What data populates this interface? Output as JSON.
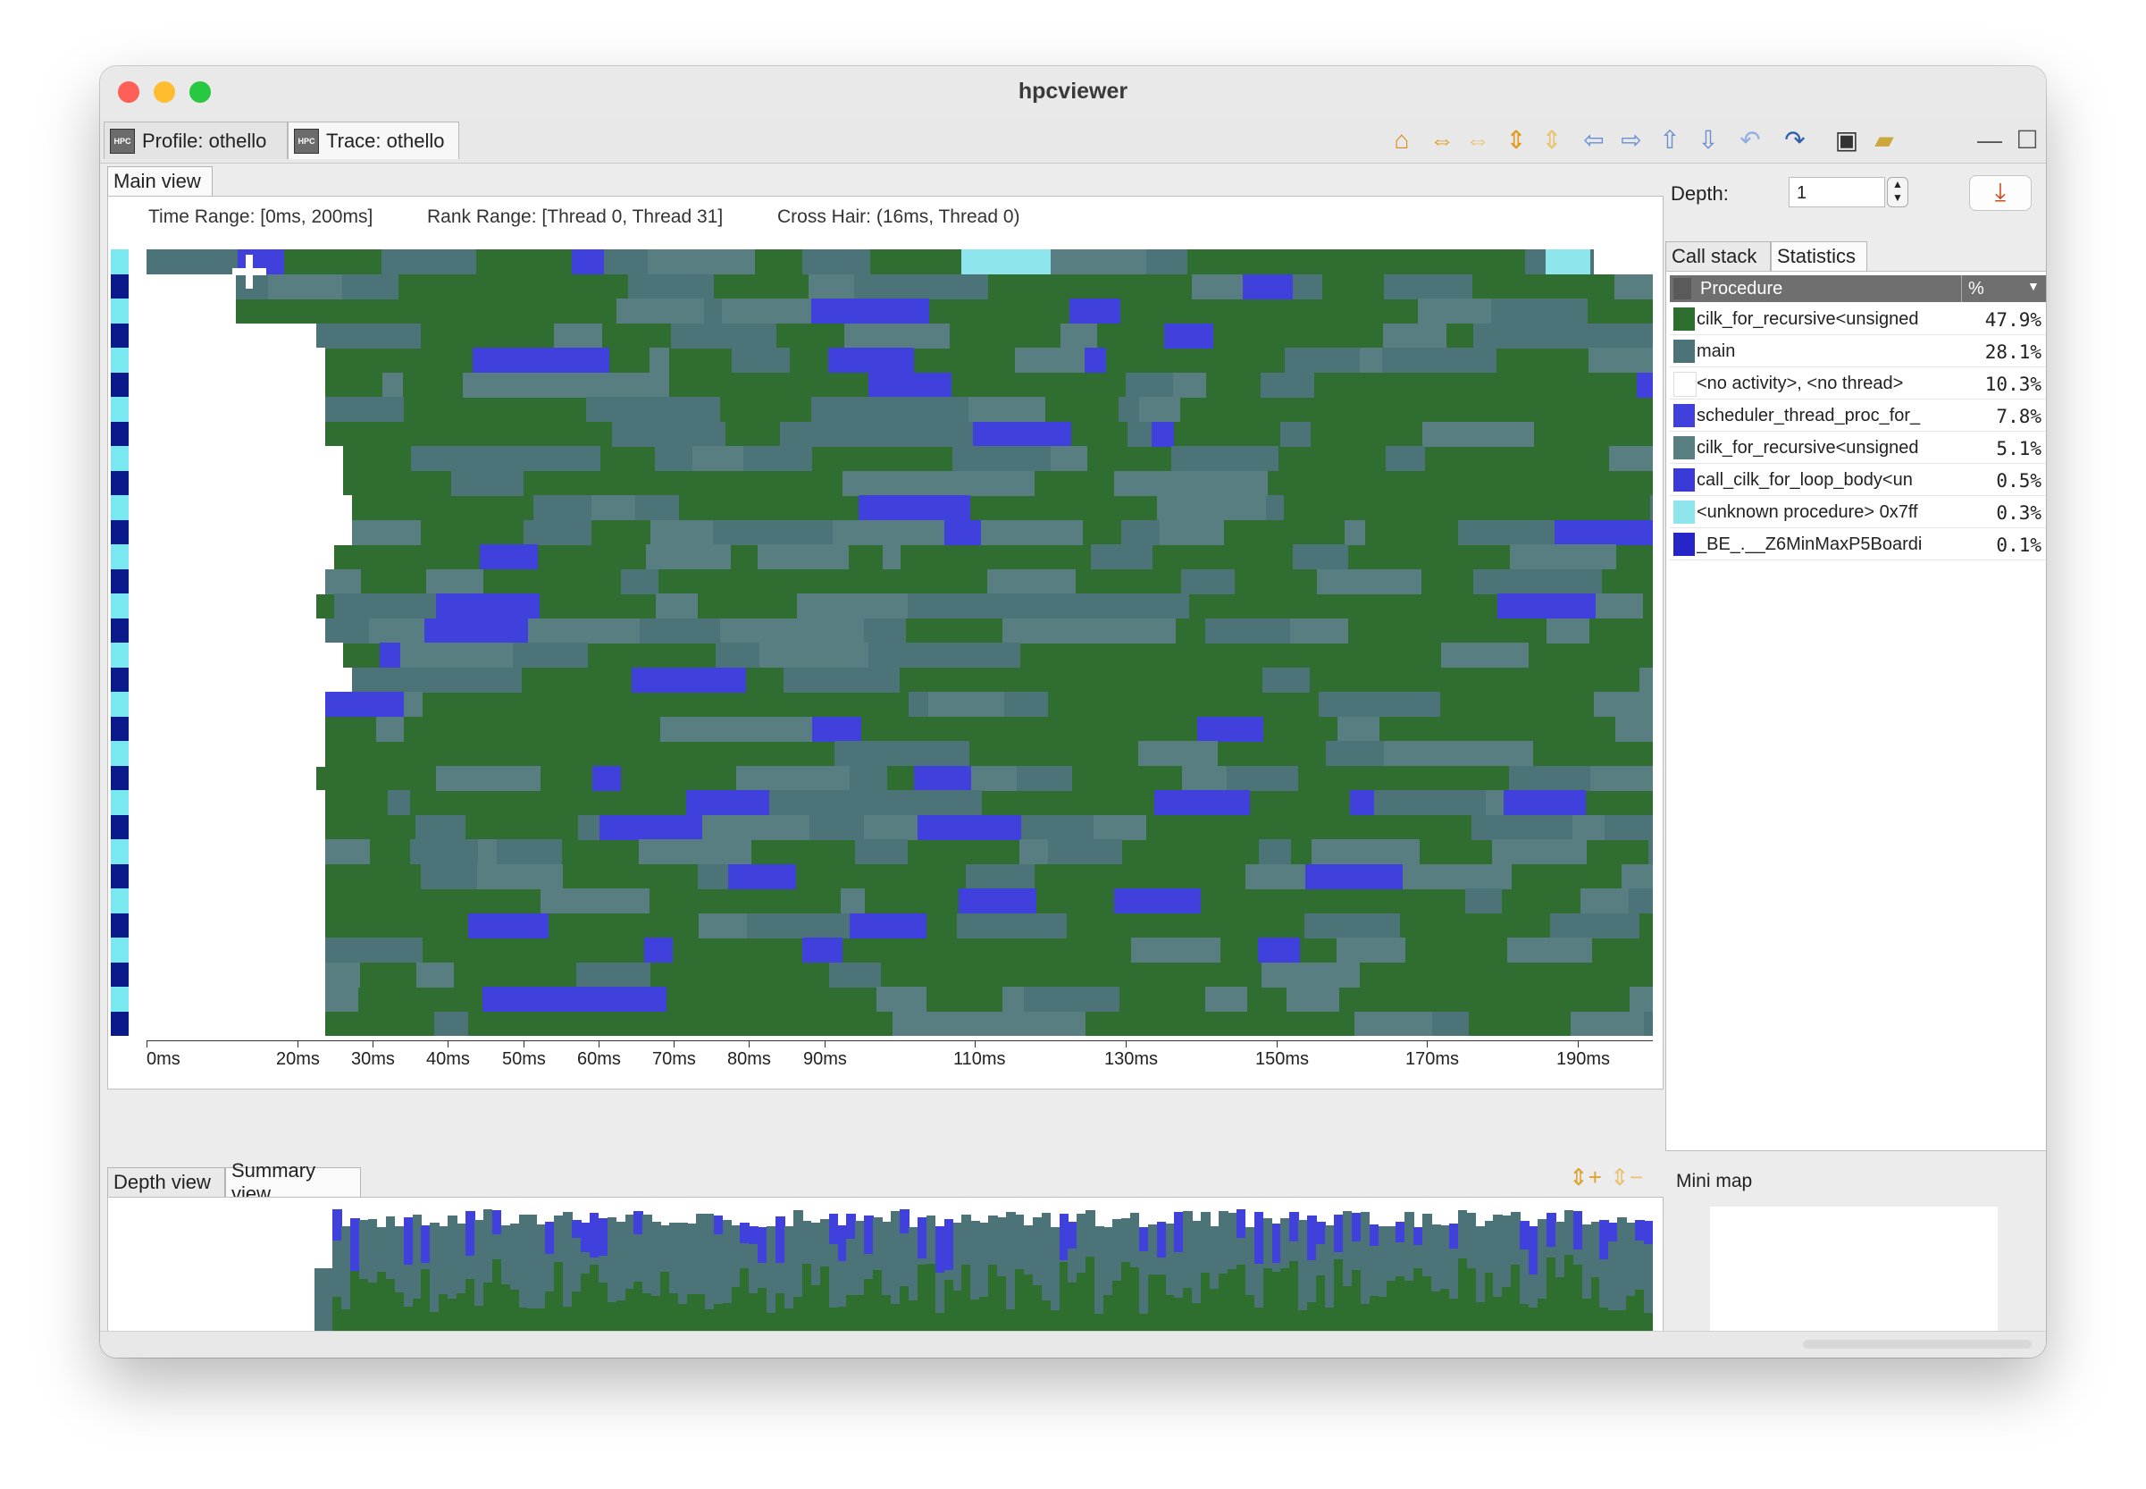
{
  "window": {
    "title": "hpcviewer",
    "traffic_lights": {
      "close": "#fe5f57",
      "minimize": "#febc2e",
      "zoom": "#28c840"
    }
  },
  "perspective_tabs": [
    {
      "label": "Profile: othello",
      "icon": "hpc-icon",
      "active": false
    },
    {
      "label": "Trace: othello",
      "icon": "hpc-icon",
      "active": true
    }
  ],
  "toolbar": {
    "buttons": [
      {
        "icon": "home-icon",
        "glyph": "⌂",
        "color": "#d98a1a"
      },
      {
        "icon": "expand-horizontal-icon",
        "glyph": "⇔",
        "color": "#e09a20"
      },
      {
        "icon": "shrink-horizontal-icon",
        "glyph": "⇔",
        "color": "#e9c272"
      },
      {
        "icon": "expand-vertical-icon",
        "glyph": "⇕",
        "color": "#e09a20"
      },
      {
        "icon": "shrink-vertical-icon",
        "glyph": "⇕",
        "color": "#e9c272"
      },
      {
        "icon": "arrow-left-icon",
        "glyph": "⇦",
        "color": "#6a8fd0"
      },
      {
        "icon": "arrow-right-icon",
        "glyph": "⇨",
        "color": "#6a8fd0"
      },
      {
        "icon": "arrow-up-icon",
        "glyph": "⇧",
        "color": "#6a8fd0"
      },
      {
        "icon": "arrow-down-icon",
        "glyph": "⇩",
        "color": "#6a8fd0"
      },
      {
        "icon": "undo-icon",
        "glyph": "↶",
        "color": "#8fb0e0"
      },
      {
        "icon": "redo-icon",
        "glyph": "↷",
        "color": "#2e5fae"
      },
      {
        "icon": "save-icon",
        "glyph": "▣",
        "color": "#333333"
      },
      {
        "icon": "open-folder-icon",
        "glyph": "▰",
        "color": "#caa73a"
      },
      {
        "icon": "minimize-icon",
        "glyph": "—",
        "color": "#555555"
      },
      {
        "icon": "maximize-icon",
        "glyph": "☐",
        "color": "#555555"
      }
    ]
  },
  "main_view": {
    "tab_label": "Main view",
    "time_range": "Time Range: [0ms, 200ms]",
    "rank_range": "Rank Range: [Thread 0, Thread 31]",
    "cross_hair": "Cross Hair: (16ms, Thread 0)"
  },
  "time_axis": [
    {
      "label": "0ms",
      "t": 0
    },
    {
      "label": "20ms",
      "t": 20
    },
    {
      "label": "30ms",
      "t": 30
    },
    {
      "label": "40ms",
      "t": 40
    },
    {
      "label": "50ms",
      "t": 50
    },
    {
      "label": "60ms",
      "t": 60
    },
    {
      "label": "70ms",
      "t": 70
    },
    {
      "label": "80ms",
      "t": 80
    },
    {
      "label": "90ms",
      "t": 90
    },
    {
      "label": "110ms",
      "t": 110
    },
    {
      "label": "130ms",
      "t": 130
    },
    {
      "label": "150ms",
      "t": 150
    },
    {
      "label": "170ms",
      "t": 170
    },
    {
      "label": "190ms",
      "t": 190
    }
  ],
  "depth_panel": {
    "label": "Depth:",
    "value": "1",
    "download_icon": "download-icon"
  },
  "side_tabs": [
    {
      "label": "Call stack",
      "active": false
    },
    {
      "label": "Statistics",
      "active": true
    }
  ],
  "stats_header": {
    "procedure": "Procedure",
    "percent": "%"
  },
  "statistics": [
    {
      "name": "cilk_for_recursive<unsigned",
      "pct": "47.9%",
      "color": "#2e6e2e"
    },
    {
      "name": "main",
      "pct": "28.1%",
      "color": "#4c7478"
    },
    {
      "name": "<no activity>, <no thread>",
      "pct": "10.3%",
      "color": "#ffffff"
    },
    {
      "name": "scheduler_thread_proc_for_",
      "pct": "7.8%",
      "color": "#4040dc"
    },
    {
      "name": "cilk_for_recursive<unsigned",
      "pct": "5.1%",
      "color": "#587e82"
    },
    {
      "name": "call_cilk_for_loop_body<un",
      "pct": "0.5%",
      "color": "#3a3ad8"
    },
    {
      "name": "<unknown procedure> 0x7ff",
      "pct": "0.3%",
      "color": "#8ee6ec"
    },
    {
      "name": "_BE_.__Z6MinMaxP5Boardi",
      "pct": "0.1%",
      "color": "#2626c8"
    }
  ],
  "bottom_tabs": [
    {
      "label": "Depth view",
      "active": false
    },
    {
      "label": "Summary view",
      "active": true
    }
  ],
  "summary_zoom_icons": [
    "zoom-in-vertical-icon",
    "zoom-out-vertical-icon"
  ],
  "mini_map": {
    "label": "Mini map"
  }
}
